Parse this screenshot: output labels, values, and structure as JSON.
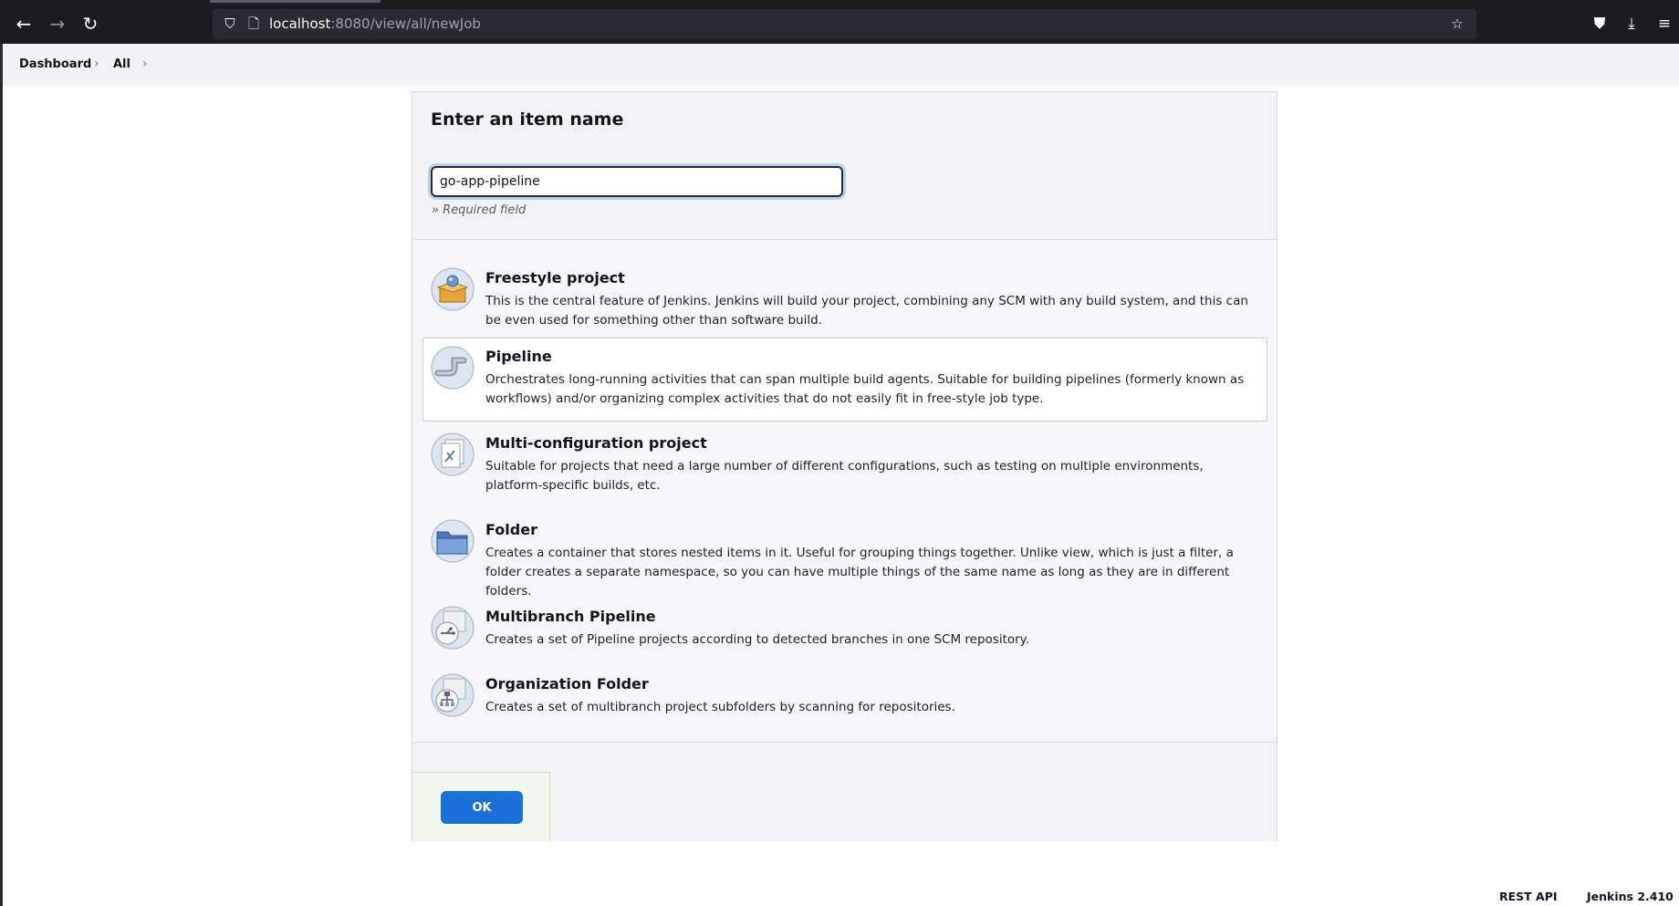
{
  "browser": {
    "url_host": "localhost",
    "url_path": ":8080/view/all/newJob",
    "back_icon": "←",
    "forward_icon": "→",
    "reload_icon": "↻",
    "shield_icon": "⛉",
    "page_icon": "🗋",
    "star_icon": "☆",
    "pocket_icon": "⛊",
    "download_icon": "⤓",
    "menu_icon": "≡"
  },
  "breadcrumb": {
    "items": [
      "Dashboard",
      "All"
    ],
    "separator": "›"
  },
  "form": {
    "title": "Enter an item name",
    "item_name_value": "go-app-pipeline",
    "required_note": "» Required field"
  },
  "item_types": [
    {
      "title": "Freestyle project",
      "description": "This is the central feature of Jenkins. Jenkins will build your project, combining any SCM with any build system, and this can be even used for something other than software build.",
      "icon": "freestyle-package-icon",
      "selected": false
    },
    {
      "title": "Pipeline",
      "description": "Orchestrates long-running activities that can span multiple build agents. Suitable for building pipelines (formerly known as workflows) and/or organizing complex activities that do not easily fit in free-style job type.",
      "icon": "pipe-icon",
      "selected": true
    },
    {
      "title": "Multi-configuration project",
      "description": "Suitable for projects that need a large number of different configurations, such as testing on multiple environments, platform-specific builds, etc.",
      "icon": "multi-config-icon",
      "selected": false
    },
    {
      "title": "Folder",
      "description": "Creates a container that stores nested items in it. Useful for grouping things together. Unlike view, which is just a filter, a folder creates a separate namespace, so you can have multiple things of the same name as long as they are in different folders.",
      "icon": "folder-icon",
      "selected": false
    },
    {
      "title": "Multibranch Pipeline",
      "description": "Creates a set of Pipeline projects according to detected branches in one SCM repository.",
      "icon": "multibranch-icon",
      "selected": false
    },
    {
      "title": "Organization Folder",
      "description": "Creates a set of multibranch project subfolders by scanning for repositories.",
      "icon": "organization-folder-icon",
      "selected": false
    }
  ],
  "ok_label": "OK",
  "footer": {
    "rest_api": "REST API",
    "version": "Jenkins 2.410"
  },
  "colors": {
    "ok_button": "#1a70d6",
    "chrome_bg": "#1c1b22",
    "breadcrumb_bg": "#f2f2f5"
  }
}
